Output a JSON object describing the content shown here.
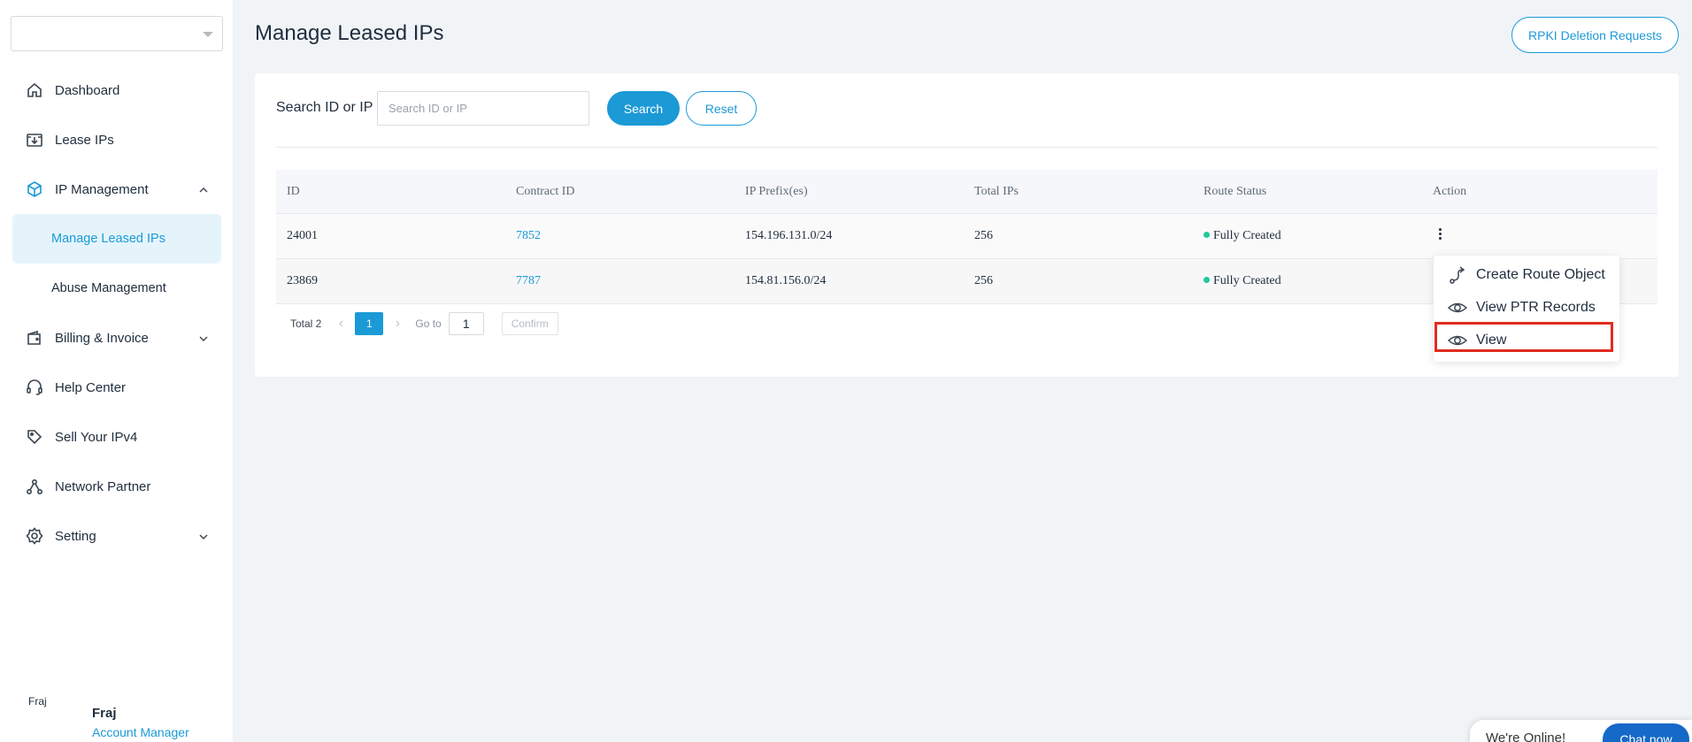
{
  "app": {
    "page_title": "Manage Leased IPs",
    "rpki_button": "RPKI Deletion Requests"
  },
  "sidebar": {
    "org_select_value": "",
    "items": [
      {
        "label": "Dashboard",
        "icon": "home-icon"
      },
      {
        "label": "Lease IPs",
        "icon": "download-box-icon"
      },
      {
        "label": "IP Management",
        "icon": "cube-icon",
        "expanded": true
      },
      {
        "label": "Manage Leased IPs",
        "sub": true,
        "active": true
      },
      {
        "label": "Abuse Management",
        "sub": true
      },
      {
        "label": "Billing & Invoice",
        "icon": "wallet-icon",
        "expanded": false
      },
      {
        "label": "Help Center",
        "icon": "headset-icon"
      },
      {
        "label": "Sell Your IPv4",
        "icon": "tag-icon"
      },
      {
        "label": "Network Partner",
        "icon": "network-icon"
      },
      {
        "label": "Setting",
        "icon": "gear-icon",
        "expanded": false
      }
    ],
    "user": {
      "avatar_alt": "Fraj",
      "name": "Fraj",
      "role": "Account Manager"
    }
  },
  "search": {
    "label": "Search ID or IP",
    "placeholder": "Search ID or IP",
    "value": "",
    "search_button": "Search",
    "reset_button": "Reset"
  },
  "table": {
    "columns": [
      "ID",
      "Contract ID",
      "IP Prefix(es)",
      "Total IPs",
      "Route Status",
      "Action"
    ],
    "rows": [
      {
        "id": "24001",
        "contract_id": "7852",
        "ip_prefix": "154.196.131.0/24",
        "total_ips": "256",
        "route_status": "Fully Created"
      },
      {
        "id": "23869",
        "contract_id": "7787",
        "ip_prefix": "154.81.156.0/24",
        "total_ips": "256",
        "route_status": "Fully Created"
      }
    ]
  },
  "pagination": {
    "total": "Total 2",
    "current_page": "1",
    "goto_label": "Go to",
    "goto_value": "1",
    "confirm": "Confirm"
  },
  "action_menu": {
    "items": [
      {
        "label": "Create Route Object",
        "icon": "route-icon"
      },
      {
        "label": "View PTR Records",
        "icon": "eye-icon"
      },
      {
        "label": "View",
        "icon": "eye-icon",
        "highlighted": true
      }
    ]
  },
  "chat": {
    "status": "We're Online!",
    "button": "Chat now"
  },
  "colors": {
    "accent": "#1b9ad6",
    "status_ok": "#20c997",
    "highlight": "#e12b1f"
  }
}
